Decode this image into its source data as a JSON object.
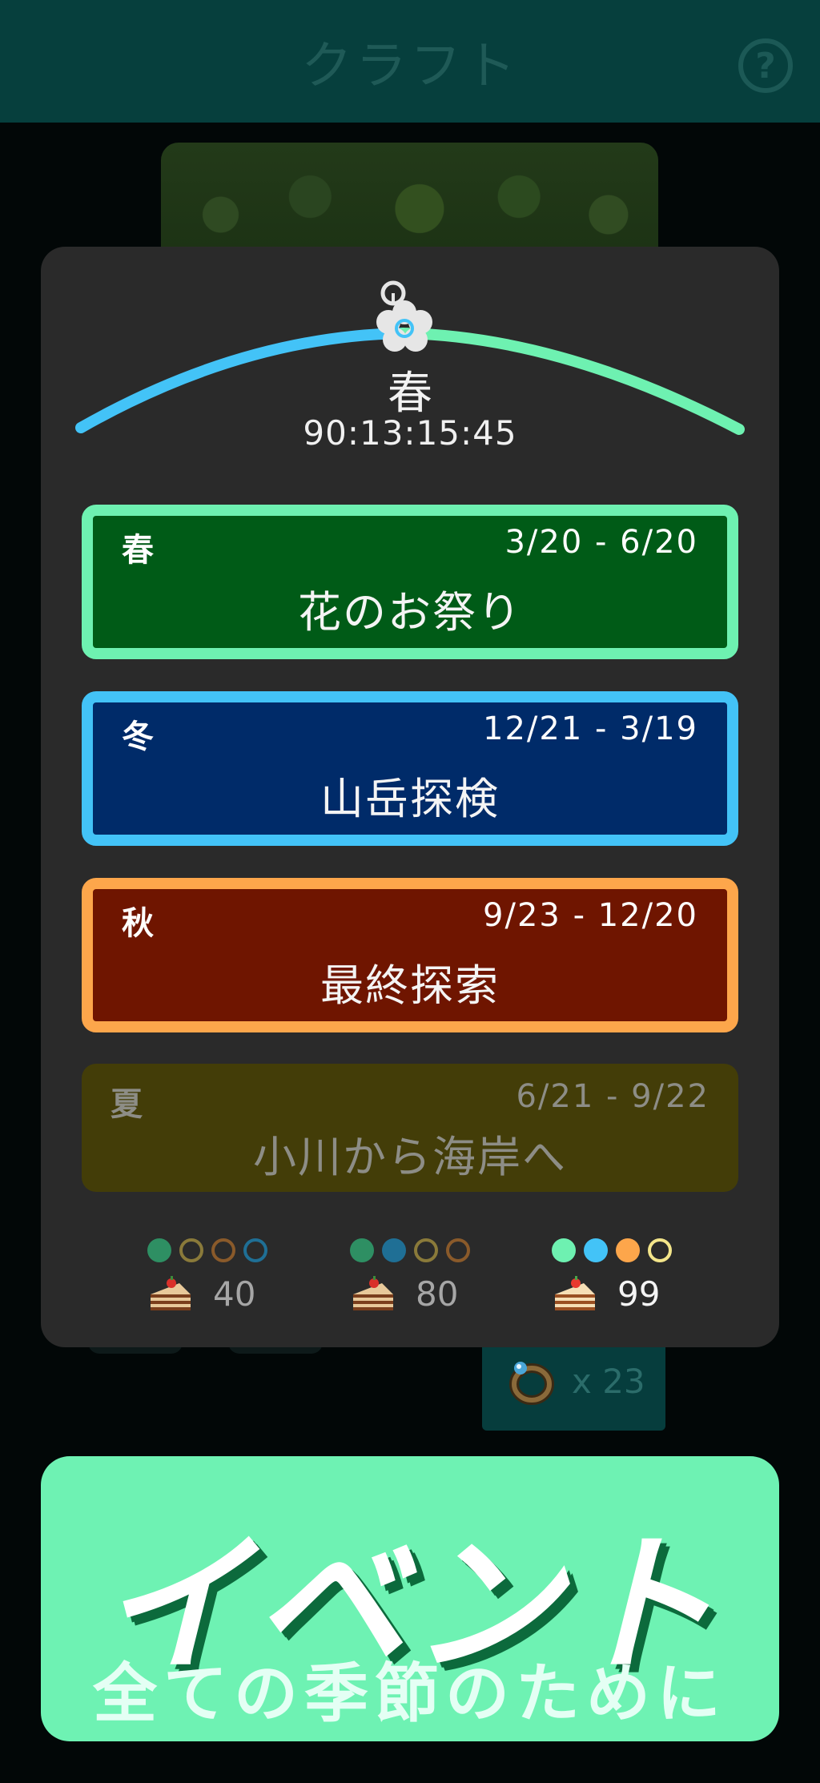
{
  "header": {
    "title": "クラフト",
    "help_label": "?"
  },
  "season_dial": {
    "current_season": "春",
    "countdown": "90:13:15:45",
    "colors": {
      "left_arc": "#43c3f7",
      "right_arc": "#6ef1b1"
    },
    "icon": "flower-icon"
  },
  "events": [
    {
      "season": "春",
      "dates": "3/20 - 6/20",
      "name": "花のお祭り",
      "fill": "#005b17",
      "border": "#6ef1b1",
      "active": true
    },
    {
      "season": "冬",
      "dates": "12/21 - 3/19",
      "name": "山岳探検",
      "fill": "#002b69",
      "border": "#43c3f7",
      "active": true
    },
    {
      "season": "秋",
      "dates": "9/23 - 12/20",
      "name": "最終探索",
      "fill": "#6f1500",
      "border": "#fda64b",
      "active": true
    },
    {
      "season": "夏",
      "dates": "6/21 - 9/22",
      "name": "小川から海岸へ",
      "fill": "#433d08",
      "border": "",
      "active": false
    }
  ],
  "rewards": [
    {
      "value": "40",
      "dots": [
        "#2e8f63",
        "ring:#8a7a3a",
        "ring:#8a5a2a",
        "ring:#1f6f95"
      ],
      "highlight": false
    },
    {
      "value": "80",
      "dots": [
        "#2e8f63",
        "#1f6f95",
        "ring:#8a7a3a",
        "ring:#8a5a2a"
      ],
      "highlight": false
    },
    {
      "value": "99",
      "dots": [
        "#6ef1b1",
        "#43c3f7",
        "#fda64b",
        "ring:#f3e58a"
      ],
      "highlight": true
    }
  ],
  "background_item": {
    "count": "x 23",
    "icon": "ring-icon"
  },
  "banner": {
    "title": "イベント",
    "subtitle": "全ての季節のために",
    "color": "#6ef2b3"
  }
}
